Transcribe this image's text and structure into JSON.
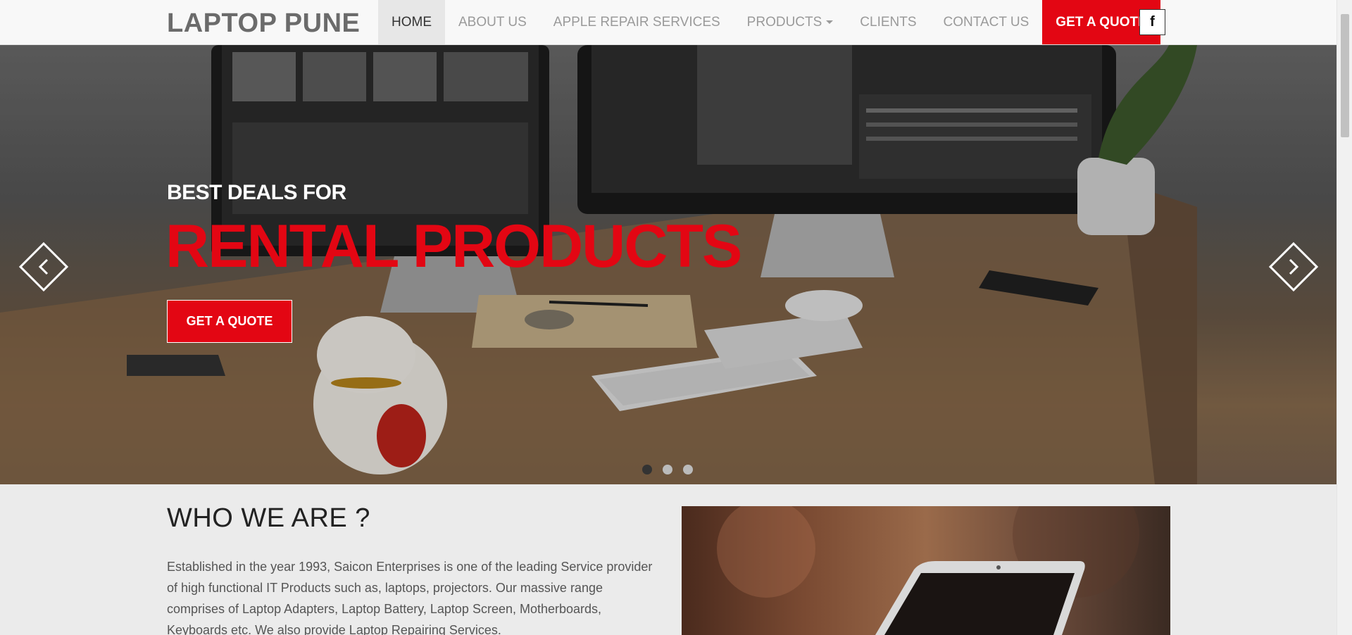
{
  "brand": "LAPTOP PUNE",
  "nav": {
    "items": [
      {
        "label": "HOME",
        "active": true
      },
      {
        "label": "ABOUT US"
      },
      {
        "label": "APPLE REPAIR SERVICES"
      },
      {
        "label": "PRODUCTS"
      },
      {
        "label": "CLIENTS"
      },
      {
        "label": "CONTACT US"
      }
    ],
    "quote_label": "GET A QUOTE",
    "facebook_icon": "facebook-icon",
    "facebook_glyph": "f"
  },
  "hero": {
    "subtitle": "BEST DEALS FOR",
    "title": "RENTAL PRODUCTS",
    "button_label": "GET A QUOTE",
    "slide_count": 3,
    "active_slide": 1,
    "prev_icon": "chevron-left-icon",
    "next_icon": "chevron-right-icon"
  },
  "about": {
    "title": "WHO WE ARE ?",
    "text": "Established in the year 1993, Saicon Enterprises is one of the leading Service provider of high functional IT Products such as, laptops, projectors. Our massive range comprises of Laptop Adapters, Laptop Battery, Laptop Screen, Motherboards, Keyboards etc. We also provide Laptop Repairing Services."
  },
  "colors": {
    "accent": "#e30613",
    "navbar_bg": "#f8f8f8",
    "active_nav_bg": "#e7e7e7",
    "page_bg": "#ebebeb"
  }
}
